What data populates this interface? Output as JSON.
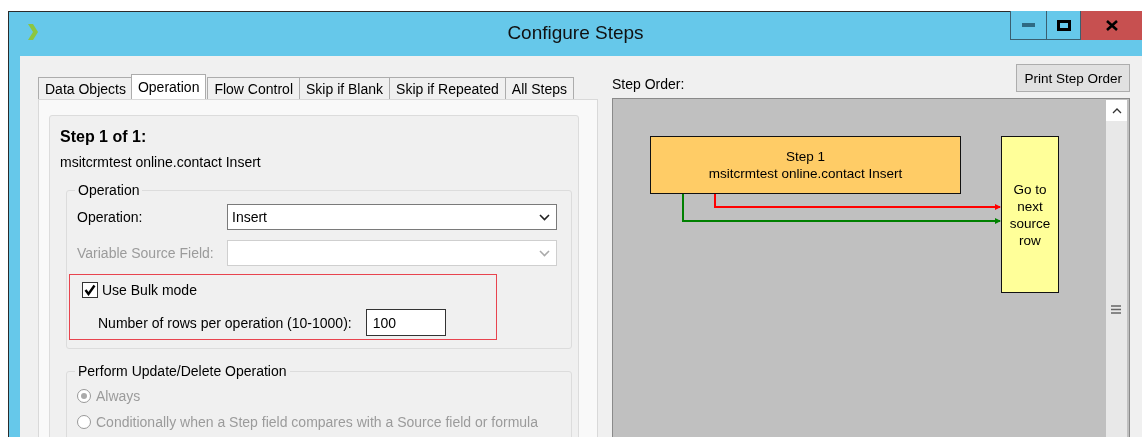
{
  "window": {
    "title": "Configure Steps"
  },
  "tabs": [
    {
      "label": "Data Objects",
      "selected": false
    },
    {
      "label": "Operation",
      "selected": true
    },
    {
      "label": "Flow Control",
      "selected": false
    },
    {
      "label": "Skip if Blank",
      "selected": false
    },
    {
      "label": "Skip if Repeated",
      "selected": false
    },
    {
      "label": "All Steps",
      "selected": false
    }
  ],
  "step_heading": "Step 1 of 1:",
  "step_name": "msitcrmtest online.contact Insert",
  "operation_group": {
    "title": "Operation",
    "operation": {
      "label": "Operation:",
      "value": "Insert",
      "disabled": false
    },
    "variable_source": {
      "label": "Variable Source Field:",
      "disabled": true
    },
    "bulk": {
      "label": "Use Bulk mode",
      "checked": true
    },
    "rows": {
      "label": "Number of rows per operation (10-1000):",
      "value": "100"
    }
  },
  "update_group": {
    "title": "Perform Update/Delete Operation",
    "disabled": true,
    "options": [
      {
        "label": "Always",
        "selected": true
      },
      {
        "label": "Conditionally when a Step field compares with a Source field or formula",
        "selected": false
      }
    ]
  },
  "step_order_label": "Step Order:",
  "print_button": "Print Step Order",
  "diagram": {
    "nodes": [
      {
        "kind": "step",
        "lines": [
          "Step 1",
          "msitcrmtest online.contact Insert"
        ]
      },
      {
        "kind": "goto",
        "text": "Go to next source row"
      }
    ],
    "connectors": [
      {
        "color": "#ff0000"
      },
      {
        "color": "#008000"
      }
    ]
  }
}
